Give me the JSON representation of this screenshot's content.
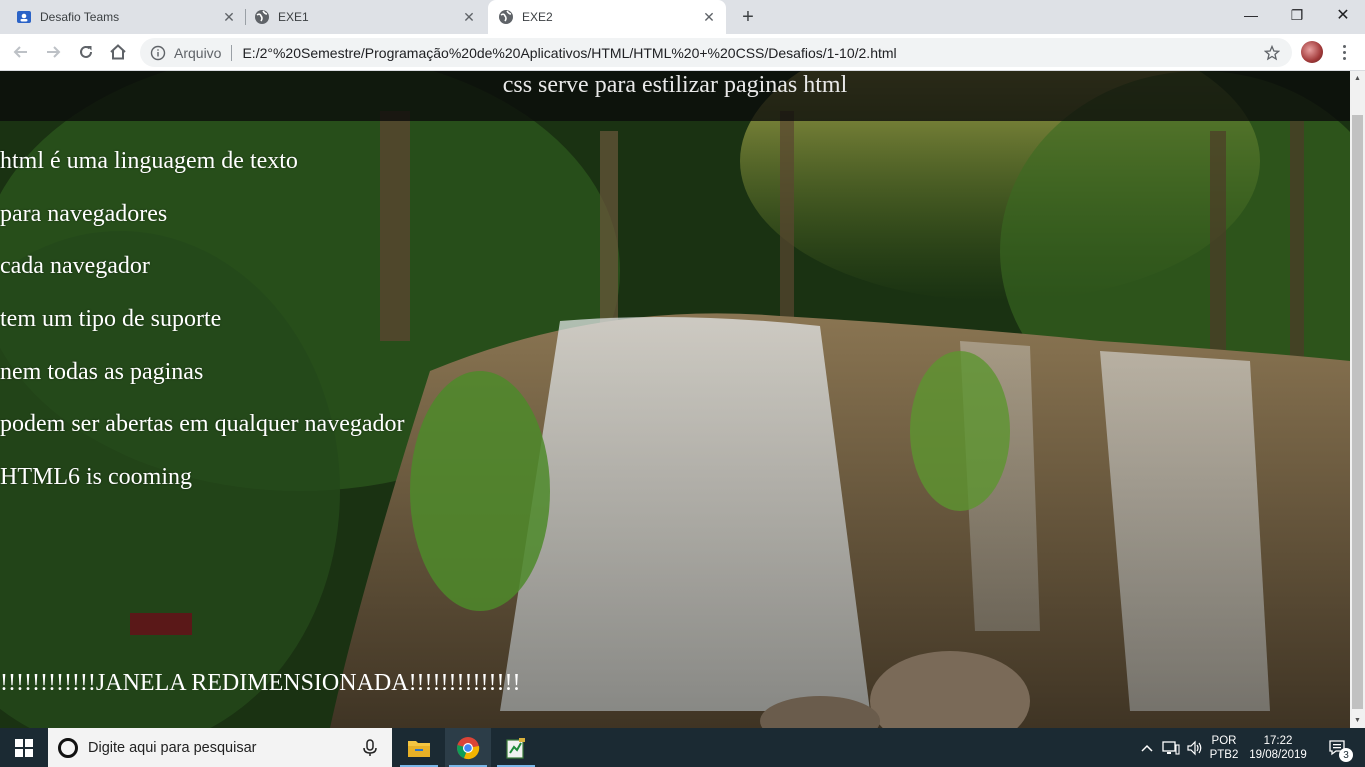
{
  "browser": {
    "tabs": [
      {
        "title": "Desafio Teams",
        "icon": "teams-icon",
        "active": false
      },
      {
        "title": "EXE1",
        "icon": "globe-icon",
        "active": false
      },
      {
        "title": "EXE2",
        "icon": "globe-icon",
        "active": true
      }
    ],
    "new_tab_glyph": "+",
    "window": {
      "minimize": "—",
      "restore": "❐",
      "close": "✕"
    },
    "address": {
      "origin_label": "Arquivo",
      "url": "E:/2°%20Semestre/Programação%20de%20Aplicativos/HTML/HTML%20+%20CSS/Desafios/1-10/2.html"
    }
  },
  "page": {
    "header": "css serve para estilizar paginas html",
    "lines": [
      "html é uma linguagem de texto",
      "para navegadores",
      "cada navegador",
      "tem um tipo de suporte",
      "nem todas as paginas",
      "podem ser abertas em qualquer navegador",
      "HTML6 is cooming"
    ],
    "resized_message": "!!!!!!!!!!!!JANELA REDIMENSIONADA!!!!!!!!!!!!!!"
  },
  "taskbar": {
    "search_placeholder": "Digite aqui para pesquisar",
    "apps": [
      "file-explorer-icon",
      "chrome-icon",
      "notepad-icon"
    ],
    "language": {
      "top": "POR",
      "bottom": "PTB2"
    },
    "time": "17:22",
    "date": "19/08/2019",
    "notifications_count": "3"
  },
  "colors": {
    "chrome_frame": "#dee1e6",
    "taskbar": "#1b2a33",
    "page_text": "#ffffff"
  }
}
